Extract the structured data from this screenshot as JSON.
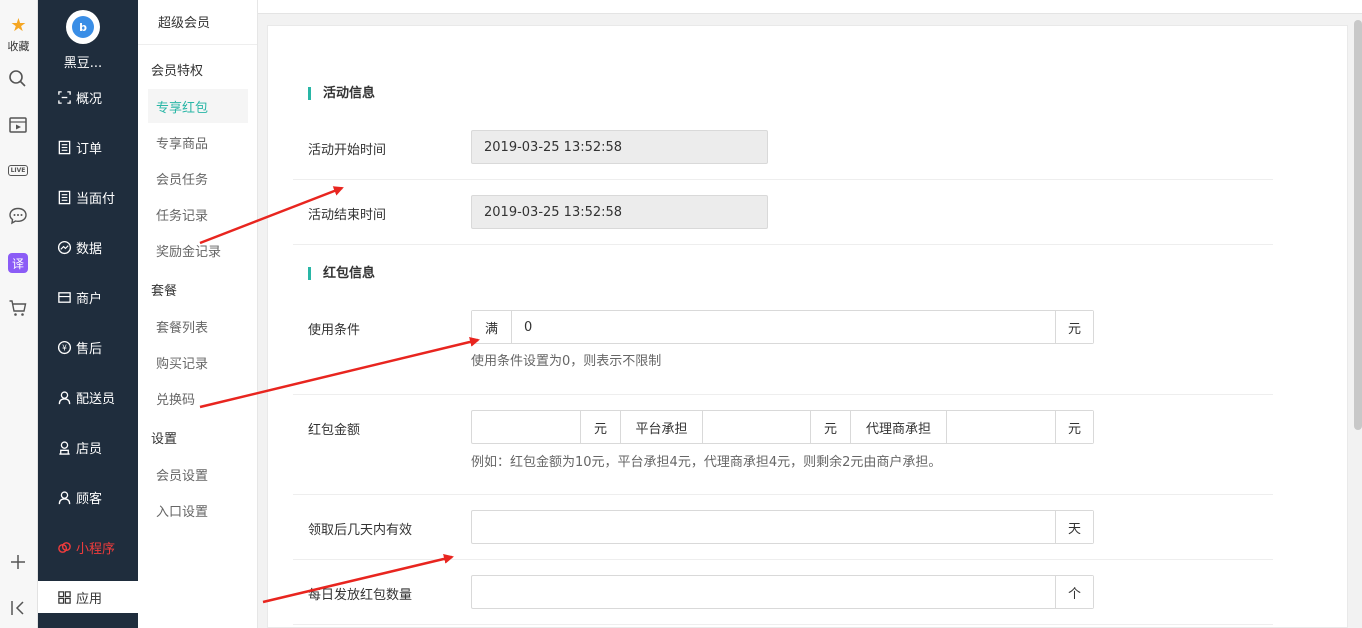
{
  "browser_strip": {
    "favorites_label": "收藏",
    "icons": [
      "star-icon",
      "search-icon",
      "video-icon",
      "live-icon",
      "chat-icon",
      "translate-icon",
      "cart-icon",
      "plus-icon",
      "collapse-icon"
    ],
    "live_text": "LIVE",
    "translate_text": "译"
  },
  "store": {
    "name": "黑豆...",
    "logo_glyph": "b"
  },
  "nav": {
    "items": [
      {
        "label": "概况",
        "icon": "overview-icon"
      },
      {
        "label": "订单",
        "icon": "order-icon"
      },
      {
        "label": "当面付",
        "icon": "pay-icon"
      },
      {
        "label": "数据",
        "icon": "chart-icon"
      },
      {
        "label": "商户",
        "icon": "shop-icon"
      },
      {
        "label": "售后",
        "icon": "aftersale-icon"
      },
      {
        "label": "配送员",
        "icon": "courier-icon"
      },
      {
        "label": "店员",
        "icon": "clerk-icon"
      },
      {
        "label": "顾客",
        "icon": "customer-icon"
      },
      {
        "label": "小程序",
        "icon": "miniapp-icon"
      },
      {
        "label": "应用",
        "icon": "apps-icon"
      }
    ]
  },
  "subnav": {
    "title": "超级会员",
    "group1": "会员特权",
    "group1_items": [
      "专享红包",
      "专享商品",
      "会员任务",
      "任务记录",
      "奖励金记录"
    ],
    "group2": "套餐",
    "group2_items": [
      "套餐列表",
      "购买记录",
      "兑换码"
    ],
    "group3": "设置",
    "group3_items": [
      "会员设置",
      "入口设置"
    ]
  },
  "form": {
    "section_activity": "活动信息",
    "start_label": "活动开始时间",
    "start_value": "2019-03-25 13:52:58",
    "end_label": "活动结束时间",
    "end_value": "2019-03-25 13:52:58",
    "section_packet": "红包信息",
    "condition_label": "使用条件",
    "condition_prefix": "满",
    "condition_value": "0",
    "condition_suffix": "元",
    "condition_help": "使用条件设置为0，则表示不限制",
    "amount_label": "红包金额",
    "amount_unit1": "元",
    "platform_label": "平台承担",
    "amount_unit2": "元",
    "agent_label": "代理商承担",
    "amount_unit3": "元",
    "amount_help": "例如：红包金额为10元，平台承担4元，代理商承担4元，则剩余2元由商户承担。",
    "valid_label": "领取后几天内有效",
    "valid_suffix": "天",
    "daily_label": "每日发放红包数量",
    "daily_suffix": "个"
  },
  "colors": {
    "accent": "#29b6a6",
    "nav_bg": "#1f2d3d",
    "arrow": "#e8251f",
    "miniapp": "#f03c3c"
  }
}
